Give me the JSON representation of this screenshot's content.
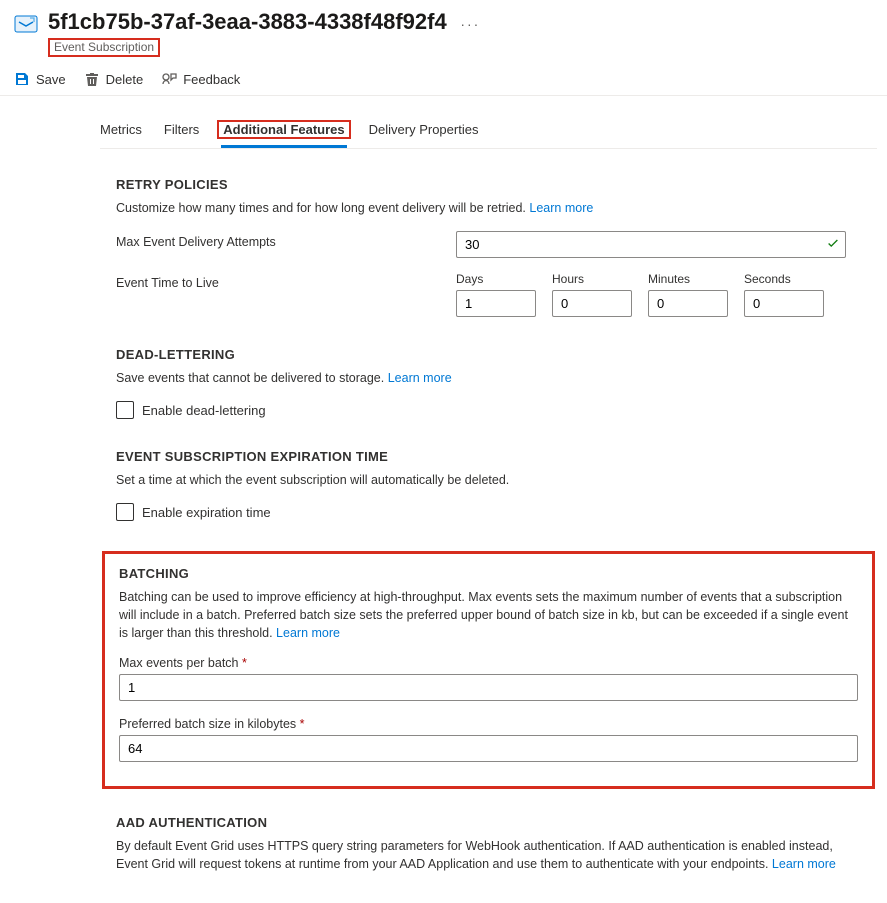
{
  "header": {
    "title": "5f1cb75b-37af-3eaa-3883-4338f48f92f4",
    "subtitle": "Event Subscription"
  },
  "commands": {
    "save": "Save",
    "delete": "Delete",
    "feedback": "Feedback"
  },
  "tabs": {
    "metrics": "Metrics",
    "filters": "Filters",
    "additional": "Additional Features",
    "delivery": "Delivery Properties"
  },
  "retry": {
    "title": "RETRY POLICIES",
    "desc": "Customize how many times and for how long event delivery will be retried.",
    "learn": "Learn more",
    "max_label": "Max Event Delivery Attempts",
    "max_value": "30",
    "ttl_label": "Event Time to Live",
    "days_label": "Days",
    "days_value": "1",
    "hours_label": "Hours",
    "hours_value": "0",
    "minutes_label": "Minutes",
    "minutes_value": "0",
    "seconds_label": "Seconds",
    "seconds_value": "0"
  },
  "dead": {
    "title": "DEAD-LETTERING",
    "desc": "Save events that cannot be delivered to storage.",
    "learn": "Learn more",
    "checkbox": "Enable dead-lettering"
  },
  "expiry": {
    "title": "EVENT SUBSCRIPTION EXPIRATION TIME",
    "desc": "Set a time at which the event subscription will automatically be deleted.",
    "checkbox": "Enable expiration time"
  },
  "batching": {
    "title": "BATCHING",
    "desc": "Batching can be used to improve efficiency at high-throughput. Max events sets the maximum number of events that a subscription will include in a batch. Preferred batch size sets the preferred upper bound of batch size in kb, but can be exceeded if a single event is larger than this threshold.",
    "learn": "Learn more",
    "max_events_label": "Max events per batch",
    "max_events_value": "1",
    "pref_size_label": "Preferred batch size in kilobytes",
    "pref_size_value": "64"
  },
  "aad": {
    "title": "AAD AUTHENTICATION",
    "desc": "By default Event Grid uses HTTPS query string parameters for WebHook authentication. If AAD authentication is enabled instead, Event Grid will request tokens at runtime from your AAD Application and use them to authenticate with your endpoints.",
    "learn": "Learn more"
  }
}
